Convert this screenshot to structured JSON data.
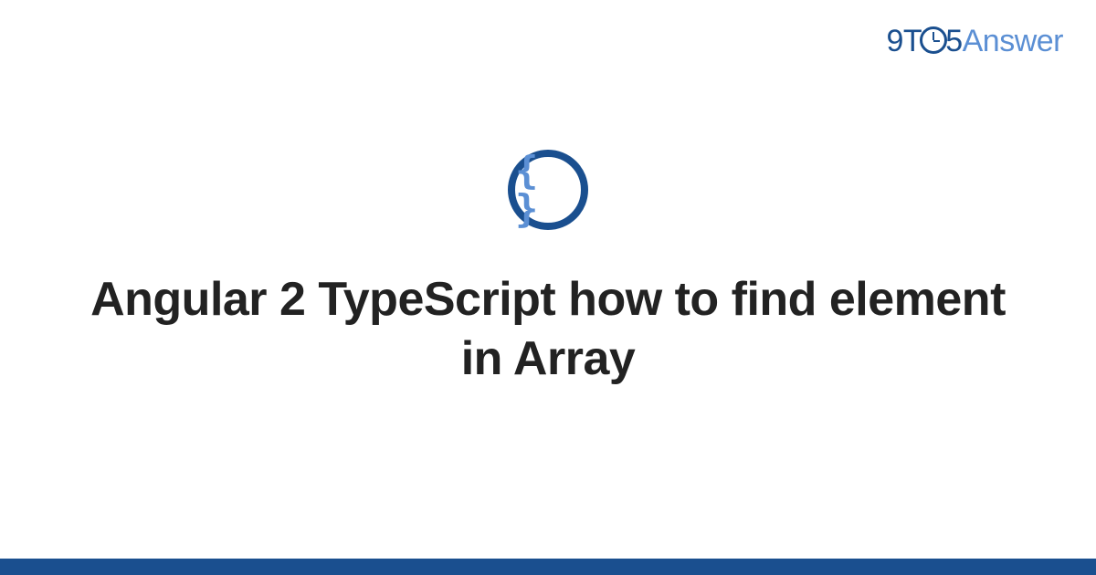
{
  "logo": {
    "part1": "9T",
    "part2": "5",
    "part3": "Answer"
  },
  "icon": {
    "name": "code-braces-icon",
    "glyph": "{ }"
  },
  "title": "Angular 2 TypeScript how to find element in Array",
  "colors": {
    "primary": "#1a4f8f",
    "secondary": "#5b8fd4"
  }
}
